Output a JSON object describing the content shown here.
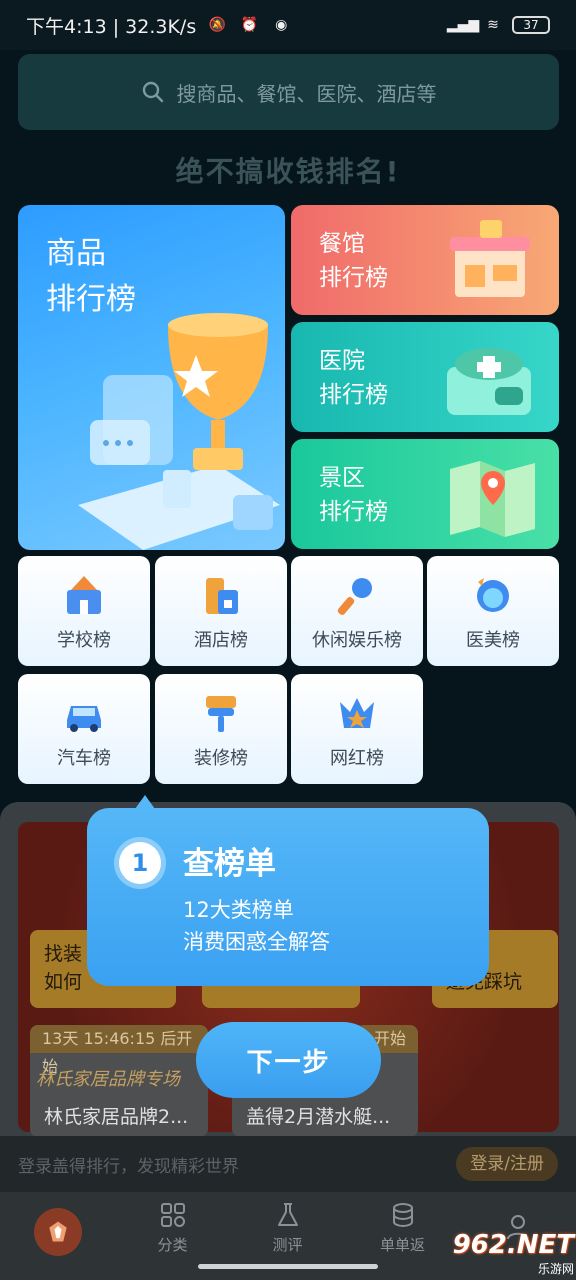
{
  "status_bar": {
    "time_speed": "下午4:13 | 32.3K/s",
    "battery": "37"
  },
  "search": {
    "placeholder": "搜商品、餐馆、医院、酒店等"
  },
  "slogan": "绝不搞收钱排名!",
  "big_card": {
    "line1": "商品",
    "line2": "排行榜"
  },
  "rank_cards": [
    {
      "line1": "餐馆",
      "line2": "排行榜"
    },
    {
      "line1": "医院",
      "line2": "排行榜"
    },
    {
      "line1": "景区",
      "line2": "排行榜"
    }
  ],
  "categories": [
    "学校榜",
    "酒店榜",
    "休闲娱乐榜",
    "医美榜",
    "汽车榜",
    "装修榜",
    "网红榜"
  ],
  "promo": {
    "pill_1_line1": "找装",
    "pill_1_line2": "如何",
    "pill_3_line1": "程",
    "pill_3_line2": "避免踩坑",
    "live_1_tag": "13天 15:46:15 后开始",
    "live_1_sub": "林氏家居品牌专场",
    "live_1_caption": "林氏家居品牌2...",
    "live_2_tag": "开始",
    "live_2_caption": "盖得2月潜水艇..."
  },
  "login_bar": {
    "text": "登录盖得排行，发现精彩世界",
    "button": "登录/注册"
  },
  "tabs": [
    "分类",
    "测评",
    "单单返"
  ],
  "tooltip": {
    "step": "1",
    "title": "查榜单",
    "line1": "12大类榜单",
    "line2": "消费困惑全解答"
  },
  "next_button": "下一步",
  "watermark": {
    "logo": "962.NET",
    "site": "乐游网"
  }
}
